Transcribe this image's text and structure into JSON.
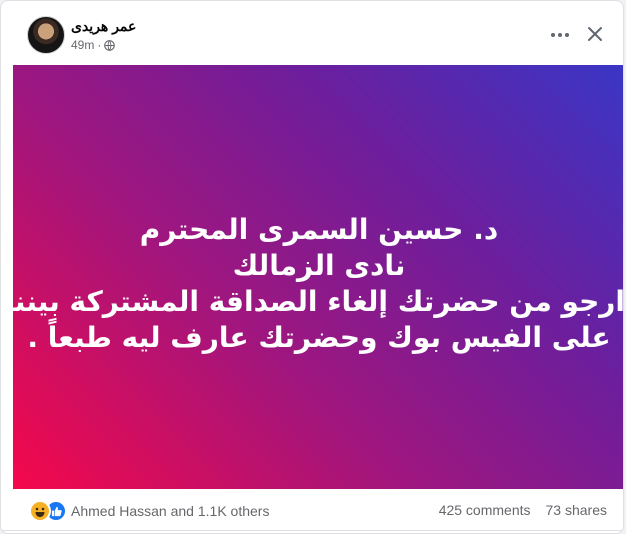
{
  "post": {
    "author": "عمر هريدى",
    "time": "49m",
    "lines": [
      "د. حسين السمرى المحترم",
      "نادى الزمالك",
      "ارجو من حضرتك إلغاء الصداقة المشتركة بيننا",
      "على الفيس بوك وحضرتك عارف ليه طبعاً ."
    ],
    "gradient_colors": [
      "#f5084a",
      "#a0167e",
      "#6d1e9c",
      "#3a36c6"
    ]
  },
  "footer": {
    "reaction_icons": [
      "haha-icon",
      "like-icon"
    ],
    "reactions_text": "Ahmed Hassan and 1.1K others",
    "comments": "425 comments",
    "shares": "73 shares"
  }
}
